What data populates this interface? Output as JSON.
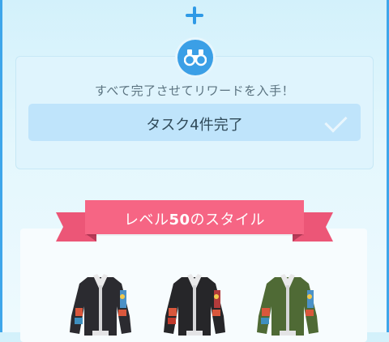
{
  "header": {
    "add_icon": "plus-icon"
  },
  "task": {
    "icon": "binoculars-icon",
    "description": "すべて完了させてリワードを入手！",
    "progress_label": "タスク4件完了",
    "status_icon": "check-icon"
  },
  "rewards": {
    "banner_prefix": "レベル",
    "banner_level": "50",
    "banner_suffix": "のスタイル",
    "items": [
      {
        "name": "jacket-black",
        "icon": "jacket-icon",
        "color": "#2b2b30"
      },
      {
        "name": "jacket-black-red",
        "icon": "jacket-icon",
        "color": "#262629"
      },
      {
        "name": "jacket-green",
        "icon": "jacket-icon",
        "color": "#4f6a35"
      }
    ]
  },
  "colors": {
    "accent": "#2f9ae6",
    "ribbon": "#f66584",
    "progress_bg": "#bfe4fb"
  }
}
